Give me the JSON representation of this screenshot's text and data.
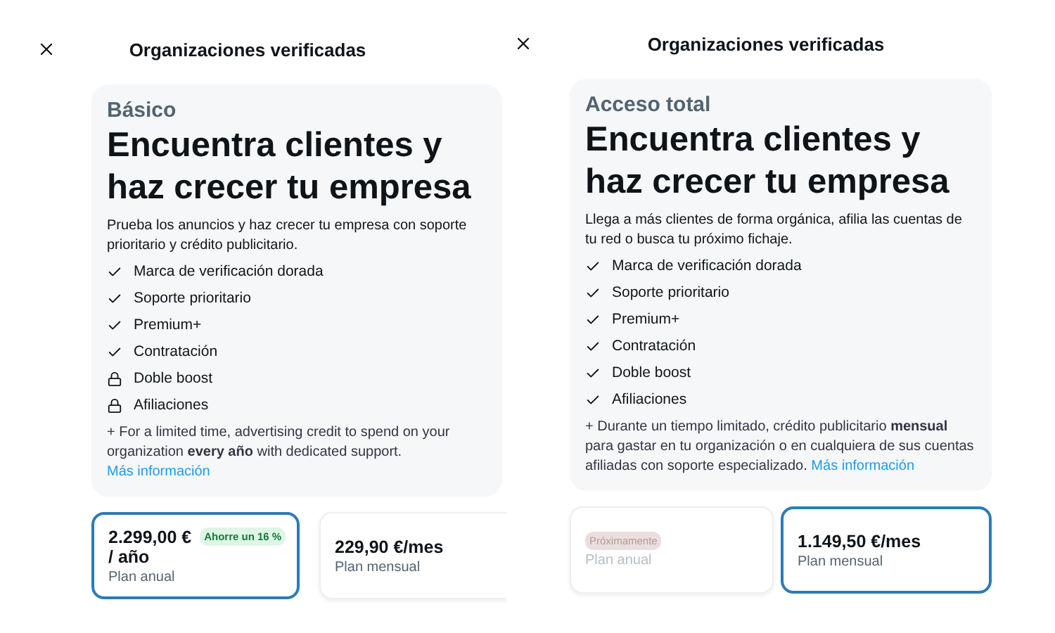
{
  "panels": [
    {
      "title": "Organizaciones verificadas",
      "tier": "Básico",
      "headline": "Encuentra clientes y haz crecer tu empresa",
      "description": "Prueba los anuncios y haz crecer tu empresa con soporte prioritario y crédito publicitario.",
      "features": [
        {
          "text": "Marca de verificación dorada",
          "kind": "check"
        },
        {
          "text": "Soporte prioritario",
          "kind": "check"
        },
        {
          "text": "Premium+",
          "kind": "check"
        },
        {
          "text": "Contratación",
          "kind": "check"
        },
        {
          "text": "Doble boost",
          "kind": "lock"
        },
        {
          "text": "Afiliaciones",
          "kind": "lock"
        }
      ],
      "note": "+ For a limited time, advertising credit to spend on your organization **every año** with dedicated support.",
      "link": "Más información",
      "plans": [
        {
          "price": "2.299,00 €",
          "period": "/ año",
          "badge": {
            "text": "Ahorre un 16 %",
            "kind": "save"
          },
          "label": "Plan anual",
          "selected": true,
          "disabled": false
        },
        {
          "price": "229,90 €/mes",
          "label": "Plan mensual",
          "selected": false,
          "disabled": false
        }
      ]
    },
    {
      "title": "Organizaciones verificadas",
      "tier": "Acceso total",
      "headline": "Encuentra clientes y haz crecer tu empresa",
      "description": "Llega a más clientes de forma orgánica, afilia las cuentas de tu red o busca tu próximo fichaje.",
      "features": [
        {
          "text": "Marca de verificación dorada",
          "kind": "check"
        },
        {
          "text": "Soporte prioritario",
          "kind": "check"
        },
        {
          "text": "Premium+",
          "kind": "check"
        },
        {
          "text": "Contratación",
          "kind": "check"
        },
        {
          "text": "Doble boost",
          "kind": "check"
        },
        {
          "text": "Afiliaciones",
          "kind": "check"
        }
      ],
      "note": "+  Durante un tiempo limitado, crédito publicitario **mensual** para gastar en tu organización o en cualquiera de sus cuentas afiliadas con soporte especializado.",
      "link": "Más información",
      "plans": [
        {
          "badge": {
            "text": "Próximamente",
            "kind": "soon"
          },
          "label": "Plan anual",
          "selected": false,
          "disabled": true
        },
        {
          "price": "1.149,50 €/mes",
          "label": "Plan mensual",
          "selected": true,
          "disabled": false
        }
      ]
    }
  ]
}
